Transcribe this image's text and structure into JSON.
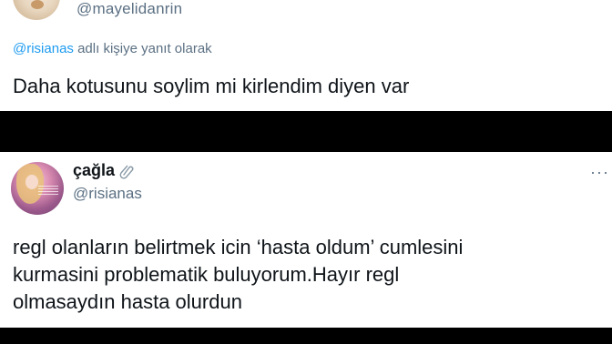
{
  "top_tweet": {
    "handle": "@mayelidanrin",
    "reply_mention": "@risianas",
    "reply_suffix": " adlı kişiye yanıt olarak",
    "text": "Daha kotusunu soylim mi kirlendim diyen var",
    "avatar_icon": "profile-photo-cat"
  },
  "bottom_tweet": {
    "display_name": "çağla",
    "name_icon": "paperclip-icon",
    "handle": "@risianas",
    "more_icon": "more-icon",
    "more_glyph": "···",
    "text_lines": [
      "regl olanların belirtmek icin ‘hasta oldum’ cumlesini",
      "kurmasini problematik buluyorum.Hayır regl",
      "olmasaydın hasta olurdun"
    ],
    "avatar_icon": "profile-photo-anime"
  },
  "colors": {
    "background": "#000000",
    "panel": "#ffffff",
    "text": "#0f1419",
    "secondary": "#5b7083",
    "mention": "#1d9bf0"
  }
}
